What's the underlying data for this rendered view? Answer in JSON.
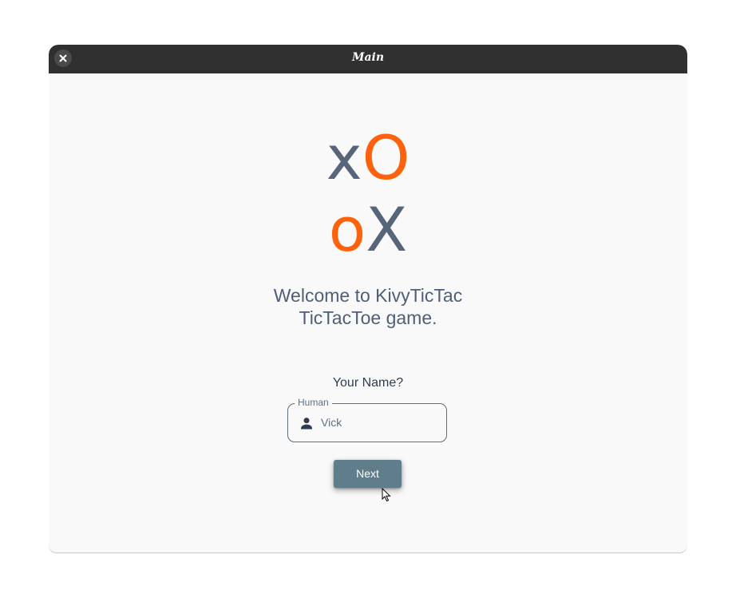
{
  "window": {
    "title": "Main",
    "close_icon": "close-icon"
  },
  "logo": {
    "line1": {
      "first": "x",
      "second": "O"
    },
    "line2": {
      "first": "o",
      "second": "X"
    },
    "colors": {
      "slate": "#56657a",
      "orange": "#fe620c"
    }
  },
  "welcome": {
    "line1": "Welcome to KivyTicTac",
    "line2": "TicTacToe game."
  },
  "form": {
    "prompt": "Your Name?",
    "field_label": "Human",
    "field_icon": "person-icon",
    "field_value": "Vick",
    "next_label": "Next"
  },
  "colors": {
    "titlebar": "#303030",
    "background": "#f9f9f9",
    "button": "#607d8b"
  }
}
